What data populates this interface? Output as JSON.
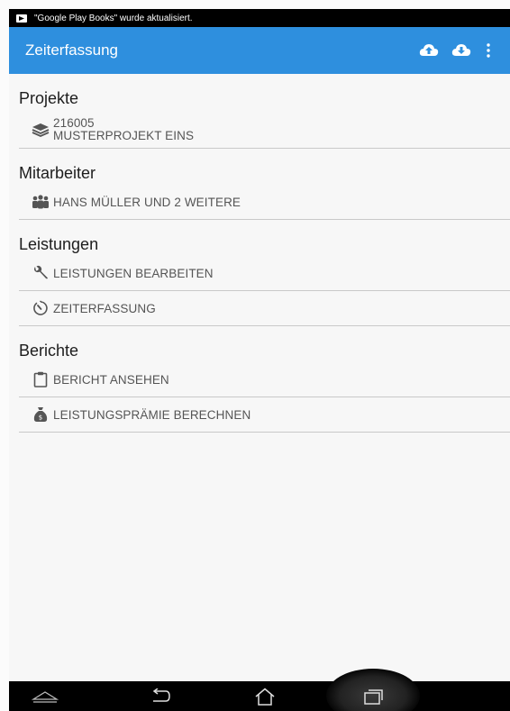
{
  "statusbar": {
    "notification": "\"Google Play Books\" wurde aktualisiert."
  },
  "appbar": {
    "title": "Zeiterfassung",
    "actions": [
      "cloud-upload-icon",
      "cloud-download-icon",
      "overflow-menu-icon"
    ]
  },
  "sections": {
    "projekte": {
      "title": "Projekte",
      "project_number": "216005",
      "project_name": "MUSTERPROJEKT EINS"
    },
    "mitarbeiter": {
      "title": "Mitarbeiter",
      "employees": "HANS MÜLLER UND 2 WEITERE"
    },
    "leistungen": {
      "title": "Leistungen",
      "edit": "LEISTUNGEN BEARBEITEN",
      "time": "ZEITERFASSUNG"
    },
    "berichte": {
      "title": "Berichte",
      "view_report": "BERICHT ANSEHEN",
      "bonus": "LEISTUNGSPRÄMIE BERECHNEN"
    }
  },
  "navbar": {
    "buttons": [
      "hide-keyboard-icon",
      "back-icon",
      "home-icon",
      "recent-apps-icon"
    ]
  },
  "colors": {
    "appbar": "#2e8fde",
    "statusbar": "#000000",
    "divider": "#c9c9c9"
  }
}
